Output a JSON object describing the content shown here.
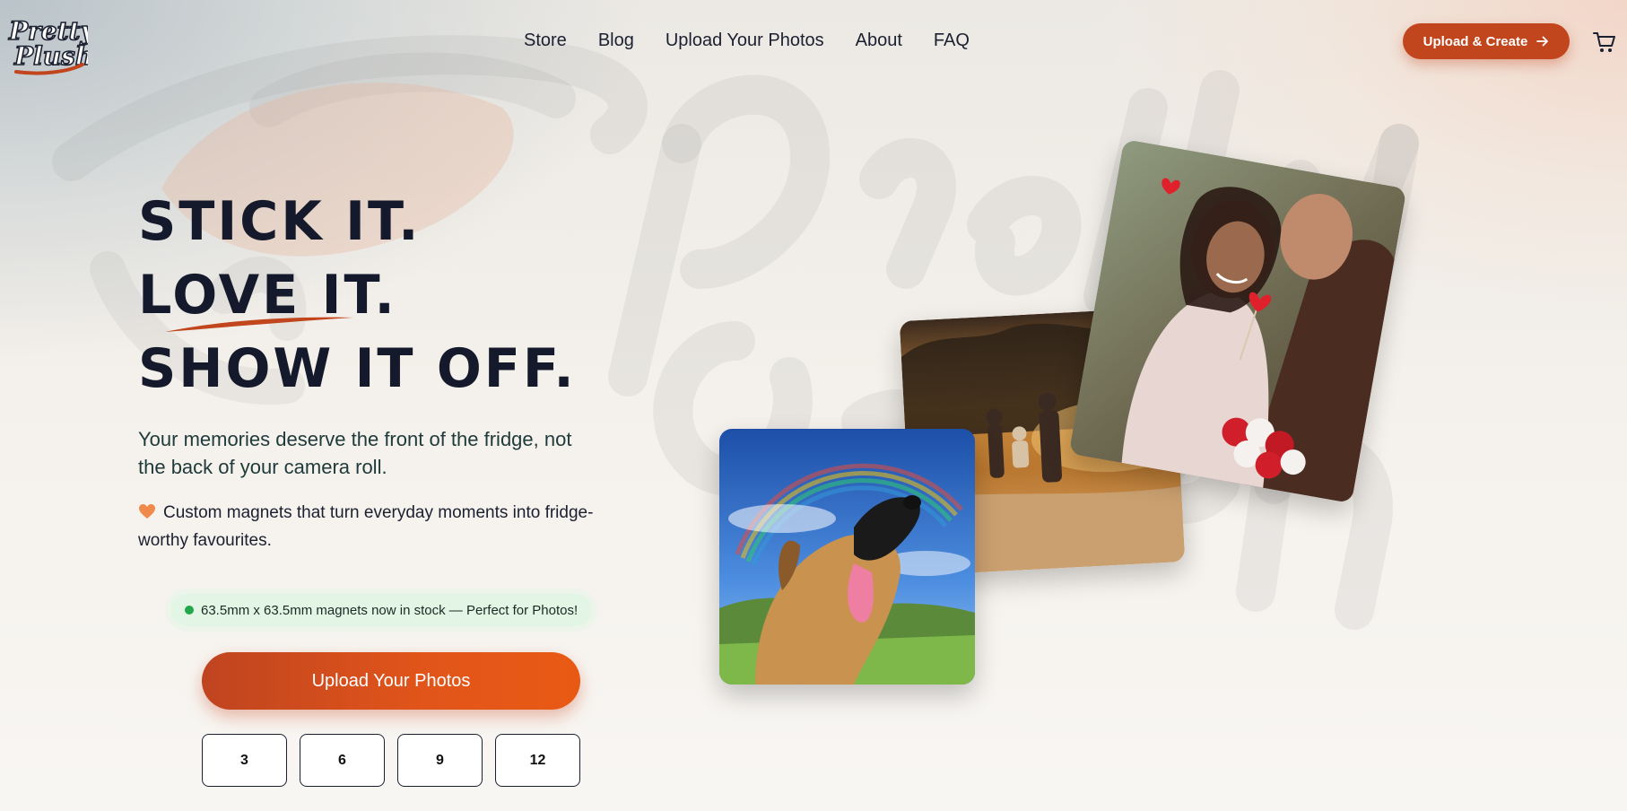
{
  "brand": {
    "logo_text_1": "Pretty",
    "logo_text_2": "Plush"
  },
  "nav": {
    "items": [
      "Store",
      "Blog",
      "Upload Your Photos",
      "About",
      "FAQ"
    ],
    "cta_label": "Upload & Create",
    "cart_icon": "cart-icon"
  },
  "hero": {
    "headline": [
      "STICK IT.",
      "LOVE IT.",
      "SHOW IT OFF."
    ],
    "subtitle": "Your memories deserve the front of the fridge, not the back of your camera roll.",
    "tagline": "Custom magnets that turn everyday moments into fridge-worthy favourites.",
    "tagline_icon": "heart-icon",
    "stock_badge": "63.5mm x 63.5mm magnets now in stock — Perfect for Photos!",
    "cta_label": "Upload Your Photos",
    "quantities": [
      "3",
      "6",
      "9",
      "12"
    ]
  },
  "photos": {
    "cards": [
      "family-walk-photo",
      "couple-photo",
      "dog-rainbow-photo"
    ]
  },
  "colors": {
    "accent": "#c2461d",
    "text_dark": "#141a2b",
    "badge_bg": "#e3f6e6",
    "badge_dot": "#22a84a"
  }
}
